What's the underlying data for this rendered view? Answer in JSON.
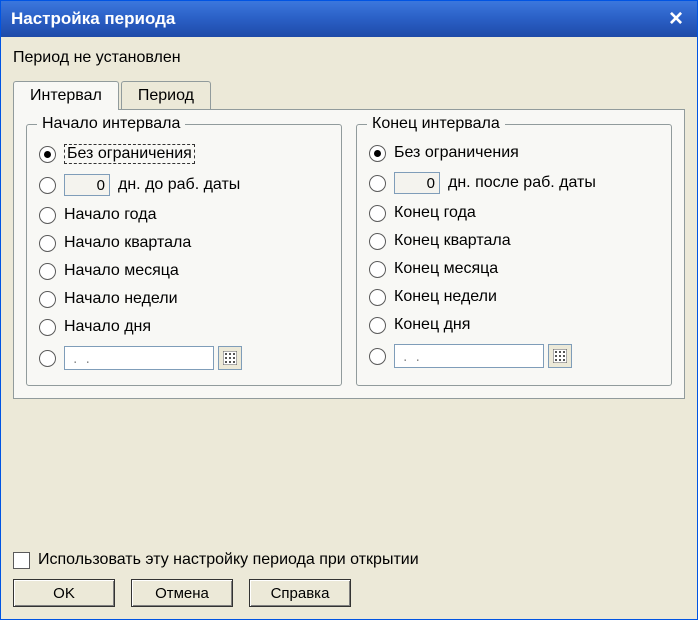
{
  "window": {
    "title": "Настройка периода"
  },
  "status": "Период не установлен",
  "tabs": {
    "interval": "Интервал",
    "period": "Период"
  },
  "start_group": {
    "legend": "Начало интервала",
    "options": {
      "no_limit": "Без ограничения",
      "days_value": "0",
      "days_suffix": "дн. до раб. даты",
      "year_start": "Начало года",
      "quarter_start": "Начало квартала",
      "month_start": "Начало месяца",
      "week_start": "Начало недели",
      "day_start": "Начало дня",
      "date_value": " .  .    "
    },
    "selected": "no_limit"
  },
  "end_group": {
    "legend": "Конец интервала",
    "options": {
      "no_limit": "Без ограничения",
      "days_value": "0",
      "days_suffix": "дн. после раб. даты",
      "year_end": "Конец года",
      "quarter_end": "Конец квартала",
      "month_end": "Конец месяца",
      "week_end": "Конец недели",
      "day_end": "Конец дня",
      "date_value": " .  .    "
    },
    "selected": "no_limit"
  },
  "checkbox": {
    "label": "Использовать эту настройку периода при открытии",
    "checked": false
  },
  "buttons": {
    "ok": "OK",
    "cancel": "Отмена",
    "help": "Справка"
  }
}
